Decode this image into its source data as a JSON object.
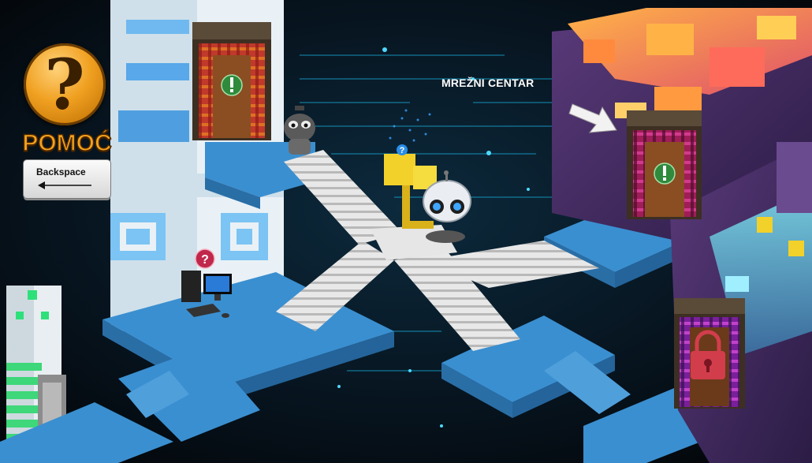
{
  "ui": {
    "help_label": "POMOĆ",
    "help_symbol": "?",
    "backspace_label": "Backspace",
    "network_center_label": "MREŽNI CENTAR"
  },
  "scene": {
    "sprites": [
      "robot",
      "question-icon",
      "hint-question-icon",
      "computer",
      "lock-icon",
      "arrow-pointer",
      "exclamation-icon"
    ]
  },
  "colors": {
    "platform": "#3a8fd0",
    "stairs": "#e6e6e6",
    "accent_gold": "#f5a31e",
    "background": "#070d14",
    "lock_red": "#d23d4c",
    "exclaim_green": "#2f8a3c"
  }
}
